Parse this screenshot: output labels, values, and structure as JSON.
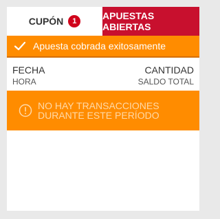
{
  "tabs": {
    "coupon_label": "CUPÓN",
    "coupon_count": "1",
    "open_bets_label": "APUESTAS ABIERTAS"
  },
  "notice": {
    "message": "Apuesta cobrada exitosamente",
    "icon": "check-icon"
  },
  "table_header": {
    "left_main": "FECHA",
    "left_sub": "HORA",
    "right_main": "CANTIDAD",
    "right_sub": "SALDO TOTAL"
  },
  "empty_state": {
    "line1": "NO HAY TRANSACCIONES",
    "line2": "DURANTE ESTE PERÍODO",
    "icon": "info-icon"
  },
  "colors": {
    "accent_orange": "#ff8c00",
    "brand_red": "#c8102e",
    "badge_red": "#d0021b"
  }
}
